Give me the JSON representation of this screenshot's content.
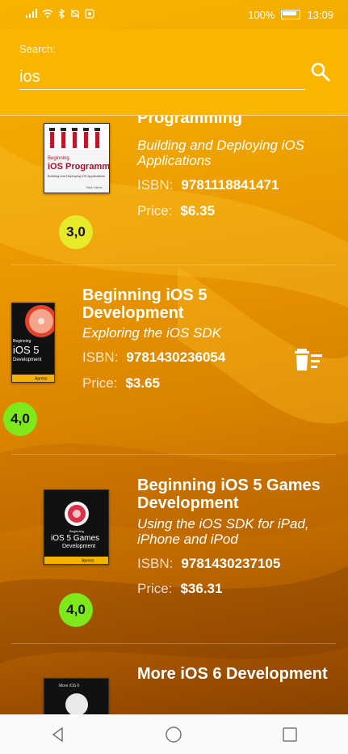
{
  "status_bar": {
    "signal": "..ıl",
    "battery_percent": "100%",
    "time": "13:09",
    "icons": [
      "signal-icon",
      "wifi-icon",
      "bluetooth-icon",
      "mute-icon",
      "screenshot-icon",
      "battery-icon"
    ]
  },
  "search": {
    "label": "Search:",
    "value": "ios",
    "icon": "search-icon"
  },
  "books": [
    {
      "title": "Programming",
      "subtitle": "Building and Deploying iOS Applications",
      "isbn_label": "ISBN:",
      "isbn": "9781118841471",
      "price_label": "Price:",
      "price": "$6.35",
      "rating": "3,0",
      "rating_color": "#e7ea2a",
      "cover": {
        "top_text": "Beginning",
        "main_text": "iOS Programming",
        "sub_text": "Building and Deploying iOS Applications",
        "author": "Nick Harris"
      }
    },
    {
      "title": "Beginning iOS 5 Development",
      "subtitle": "Exploring the iOS SDK",
      "isbn_label": "ISBN:",
      "isbn": "9781430236054",
      "price_label": "Price:",
      "price": "$3.65",
      "rating": "4,0",
      "rating_color": "#7de81a",
      "cover": {
        "top_text": "Beginning",
        "main_text": "iOS 5",
        "sub_text": "Development",
        "author": "Apress"
      }
    },
    {
      "title": "Beginning iOS 5 Games Development",
      "subtitle": "Using the iOS SDK for iPad, iPhone and iPod",
      "isbn_label": "ISBN:",
      "isbn": "9781430237105",
      "price_label": "Price:",
      "price": "$36.31",
      "rating": "4,0",
      "rating_color": "#7de81a",
      "cover": {
        "top_text": "Beginning",
        "main_text": "iOS 5 Games",
        "sub_text": "Development",
        "author": "Apress"
      }
    },
    {
      "title": "More iOS 6 Development",
      "cover": {
        "top_text": "More iOS 6"
      }
    }
  ],
  "delete_icon": "delete-sweep-icon",
  "nav": [
    "back-icon",
    "home-icon",
    "recents-icon"
  ]
}
